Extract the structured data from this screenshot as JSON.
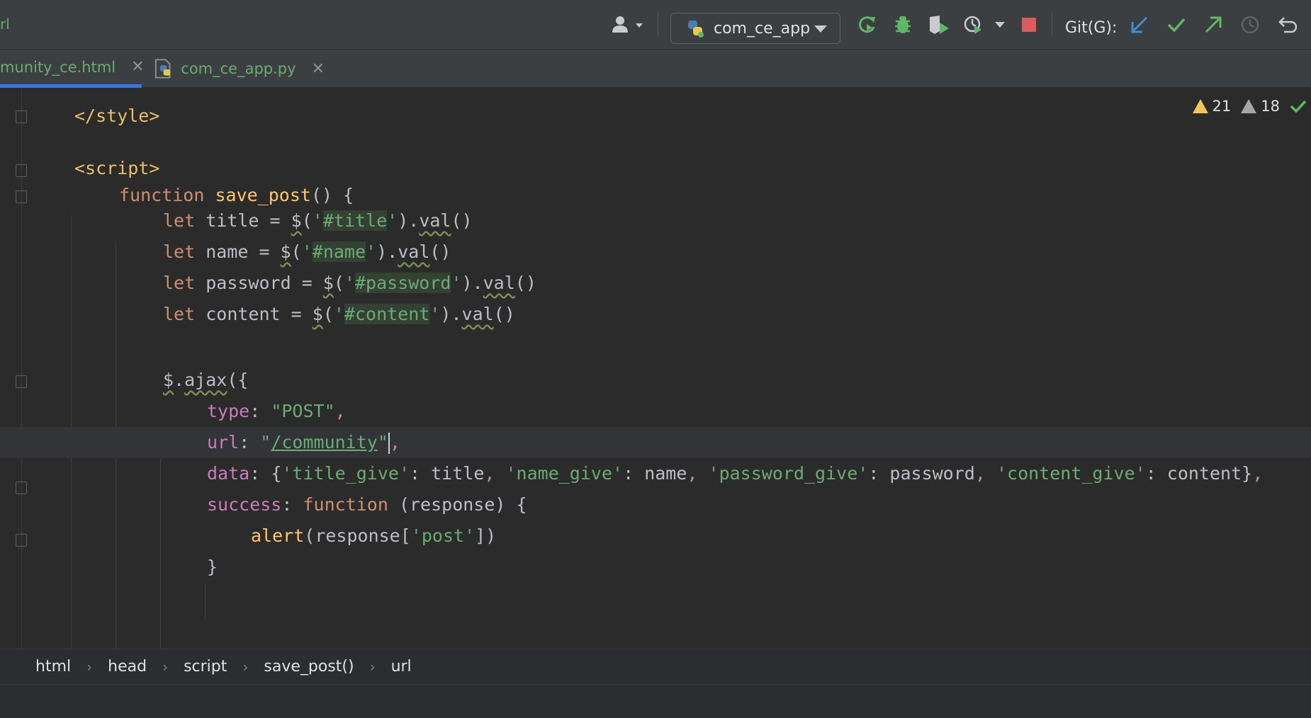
{
  "toolbar": {
    "left_fragment": "rl",
    "run_config_label": "com_ce_app",
    "git_label": "Git(G):"
  },
  "tabs": [
    {
      "label": "munity_ce.html",
      "active": true
    },
    {
      "label": "com_ce_app.py",
      "active": false
    }
  ],
  "inspections": {
    "warnings": "21",
    "weak_warnings": "18"
  },
  "code": {
    "style_close": "</style>",
    "script_open": "<script>",
    "func_kw": "function",
    "func_name": "save_post",
    "let_kw": "let",
    "var_title": "title",
    "var_name": "name",
    "var_password": "password",
    "var_content": "content",
    "sel_title": "#title",
    "sel_name": "#name",
    "sel_password": "#password",
    "sel_content": "#content",
    "val": "val",
    "ajax": "ajax",
    "type_key": "type",
    "type_val": "\"POST\"",
    "url_key": "url",
    "url_val": "/community",
    "data_key": "data",
    "k_title": "'title_give'",
    "k_name": "'name_give'",
    "k_password": "'password_give'",
    "k_content": "'content_give'",
    "success_key": "success",
    "response": "response",
    "alert": "alert",
    "post_key": "'post'"
  },
  "breadcrumb": [
    "html",
    "head",
    "script",
    "save_post()",
    "url"
  ],
  "colors": {
    "accent": "#3574f0",
    "string": "#6aab73",
    "keyword": "#cf8e6d",
    "function_name": "#ffc66d",
    "property": "#c77dbb",
    "stop": "#db5c5c",
    "run": "#5fb865"
  },
  "icons": [
    "user-icon",
    "python-icon",
    "rerun-icon",
    "debug-icon",
    "coverage-icon",
    "profile-icon",
    "stop-icon",
    "git-update-icon",
    "git-commit-icon",
    "git-push-icon",
    "history-icon",
    "rollback-icon"
  ]
}
